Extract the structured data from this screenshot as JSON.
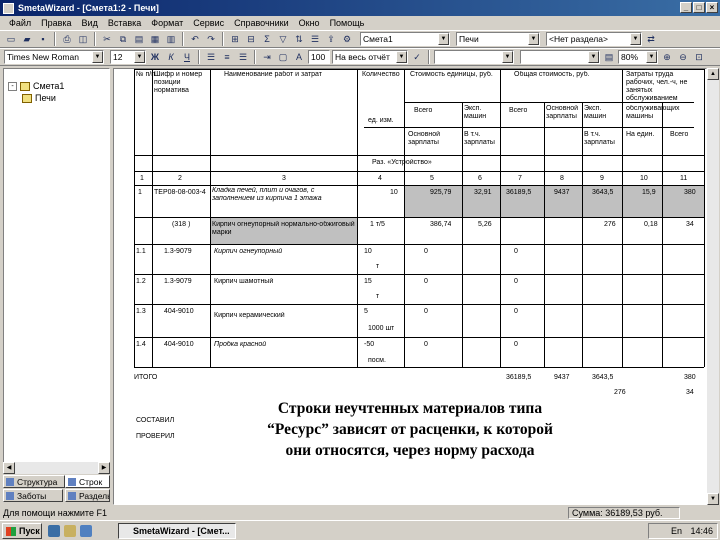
{
  "window": {
    "title": "SmetaWizard - [Смета1:2 - Печи]",
    "min": "_",
    "max": "□",
    "close": "×"
  },
  "menu": [
    "Файл",
    "Правка",
    "Вид",
    "Вставка",
    "Формат",
    "Сервис",
    "Справочники",
    "Окно",
    "Помощь"
  ],
  "toolbar1": {
    "estimate_combo": "Смета1",
    "section_combo": "Печи",
    "section2_combo": "<Нет раздела>",
    "icons": [
      "new-icon",
      "open-icon",
      "save-icon",
      "print-icon",
      "preview-icon",
      "cut-icon",
      "copy-icon",
      "paste-icon",
      "undo-icon",
      "redo-icon"
    ]
  },
  "toolbar2": {
    "font_combo": "Times New Roman",
    "size_combo": "12",
    "bold": "Ж",
    "italic": "К",
    "underline": "Ч",
    "left_value": "100",
    "scope_combo": "На весь отчёт",
    "zoom_combo": "80%"
  },
  "tree": {
    "root": "Смета1",
    "child": "Печи",
    "expand": "-"
  },
  "tabs": {
    "structure": "Структура",
    "order": "Строк",
    "works": "Заботы",
    "sections": "Разделы"
  },
  "report": {
    "headers": {
      "num": "№ п/п",
      "code": "Шифр и номер позиции норматива",
      "name": "Наименование работ и затрат",
      "unit_qty": "Количество",
      "unit_cost": "Стоимость единицы, руб.",
      "total_cost": "Общая стоимость, руб.",
      "labor": "Затраты труда рабочих, чел.-ч, не занятых обслуживанием",
      "all": "Всего",
      "mach": "Эксп. машин",
      "all2": "Всего",
      "basic": "Основной зарплаты",
      "mach2": "Эксп. машин",
      "servicing": "обслуживающих машины",
      "unit_label": "ед. изм.",
      "basic_pay": "Основной зарплаты",
      "incl_pay": "В т.ч. зарплаты",
      "incl_pay2": "В т.ч. зарплаты",
      "per_unit": "На един.",
      "total": "Всего"
    },
    "section_title": "Раз. «Устройство»",
    "col_numbers": [
      "1",
      "2",
      "3",
      "4",
      "5",
      "6",
      "7",
      "8",
      "9",
      "10",
      "11"
    ],
    "rows": [
      {
        "num": "1",
        "code": "ТЕР08-08-003-4",
        "name": "Кладка печей, плит и очагов, с заполнением из кирпича 1 этажа",
        "qty": "10",
        "unit_cost": "925,79",
        "mach": "32,91",
        "total": "36189,5",
        "basic": "9437",
        "mach2": "3643,5",
        "labor_u": "15,9",
        "labor_t": "380"
      },
      {
        "num": "",
        "code": "(318 )",
        "name": "Кирпич огнеупорный нормально-обжиговый марки",
        "qty": "1 т/5",
        "unit_cost": "386,74",
        "mach": "5,26",
        "total": "",
        "basic": "",
        "mach2": "276",
        "labor_u": "0,18",
        "labor_t": "34"
      },
      {
        "num": "1.1",
        "code": "1.3-9079",
        "name": "Кирпич огнеупорный",
        "qty": "10",
        "qty_unit": "т",
        "unit_cost": "0",
        "total": "0"
      },
      {
        "num": "1.2",
        "code": "1.3-9079",
        "name": "Кирпич шамотный",
        "qty": "15",
        "qty_unit": "т",
        "unit_cost": "0",
        "total": "0"
      },
      {
        "num": "1.3",
        "code": "404-9010",
        "name": "Кирпич керамический",
        "qty": "5",
        "qty_unit": "1000 шт",
        "unit_cost": "0",
        "total": "0"
      },
      {
        "num": "1.4",
        "code": "404-9010",
        "name": "Пробка красной",
        "qty": "-50",
        "qty_unit": "посм.",
        "unit_cost": "0",
        "total": "0"
      }
    ],
    "itogo": {
      "label": "ИТОГО",
      "total": "36189,5",
      "basic": "9437",
      "mach2": "3643,5",
      "labor": "380",
      "sub1": "276",
      "sub2": "34"
    },
    "footer1": "СОСТАВИЛ",
    "footer2": "ПРОВЕРИЛ"
  },
  "caption": "Строки неучтенных материалов типа\n“Ресурс” зависят от расценки, к которой\nони относятся, через норму расхода",
  "status": {
    "left": "Для помощи нажмите F1",
    "right": "Сумма: 36189,53 руб."
  },
  "taskbar": {
    "start": "Пуск",
    "task": "SmetaWizard - [Смет...",
    "clock": "14:46",
    "lang": "En"
  }
}
